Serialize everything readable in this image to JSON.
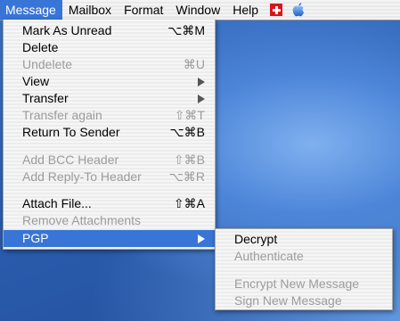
{
  "menubar": {
    "items": [
      "Message",
      "Mailbox",
      "Format",
      "Window",
      "Help"
    ],
    "icons": [
      "swiss-flag-icon",
      "apple-icon"
    ]
  },
  "message_menu": {
    "items": [
      {
        "label": "Mark As Unread",
        "shortcut": "⌥⌘M",
        "enabled": true
      },
      {
        "label": "Delete",
        "shortcut": "",
        "enabled": true
      },
      {
        "label": "Undelete",
        "shortcut": "⌘U",
        "enabled": false
      },
      {
        "label": "View",
        "submenu": true,
        "enabled": true
      },
      {
        "label": "Transfer",
        "submenu": true,
        "enabled": true
      },
      {
        "label": "Transfer again",
        "shortcut": "⇧⌘T",
        "enabled": false
      },
      {
        "label": "Return To Sender",
        "shortcut": "⌥⌘B",
        "enabled": true
      },
      {
        "label": "Add BCC Header",
        "shortcut": "⇧⌘B",
        "enabled": false
      },
      {
        "label": "Add Reply-To Header",
        "shortcut": "⌥⌘R",
        "enabled": false
      },
      {
        "label": "Attach File...",
        "shortcut": "⇧⌘A",
        "enabled": true
      },
      {
        "label": "Remove Attachments",
        "shortcut": "",
        "enabled": false
      },
      {
        "label": "PGP",
        "submenu": true,
        "enabled": true,
        "highlighted": true
      }
    ]
  },
  "pgp_submenu": {
    "items": [
      {
        "label": "Decrypt",
        "enabled": true
      },
      {
        "label": "Authenticate",
        "enabled": false
      },
      {
        "label": "Encrypt New Message",
        "enabled": false
      },
      {
        "label": "Sign New Message",
        "enabled": false
      }
    ]
  },
  "colors": {
    "highlight": "#3875d7",
    "disabled_text": "#9c9c9c",
    "flag_red": "#d9141b",
    "apple_blue": "#3a7bd5"
  }
}
